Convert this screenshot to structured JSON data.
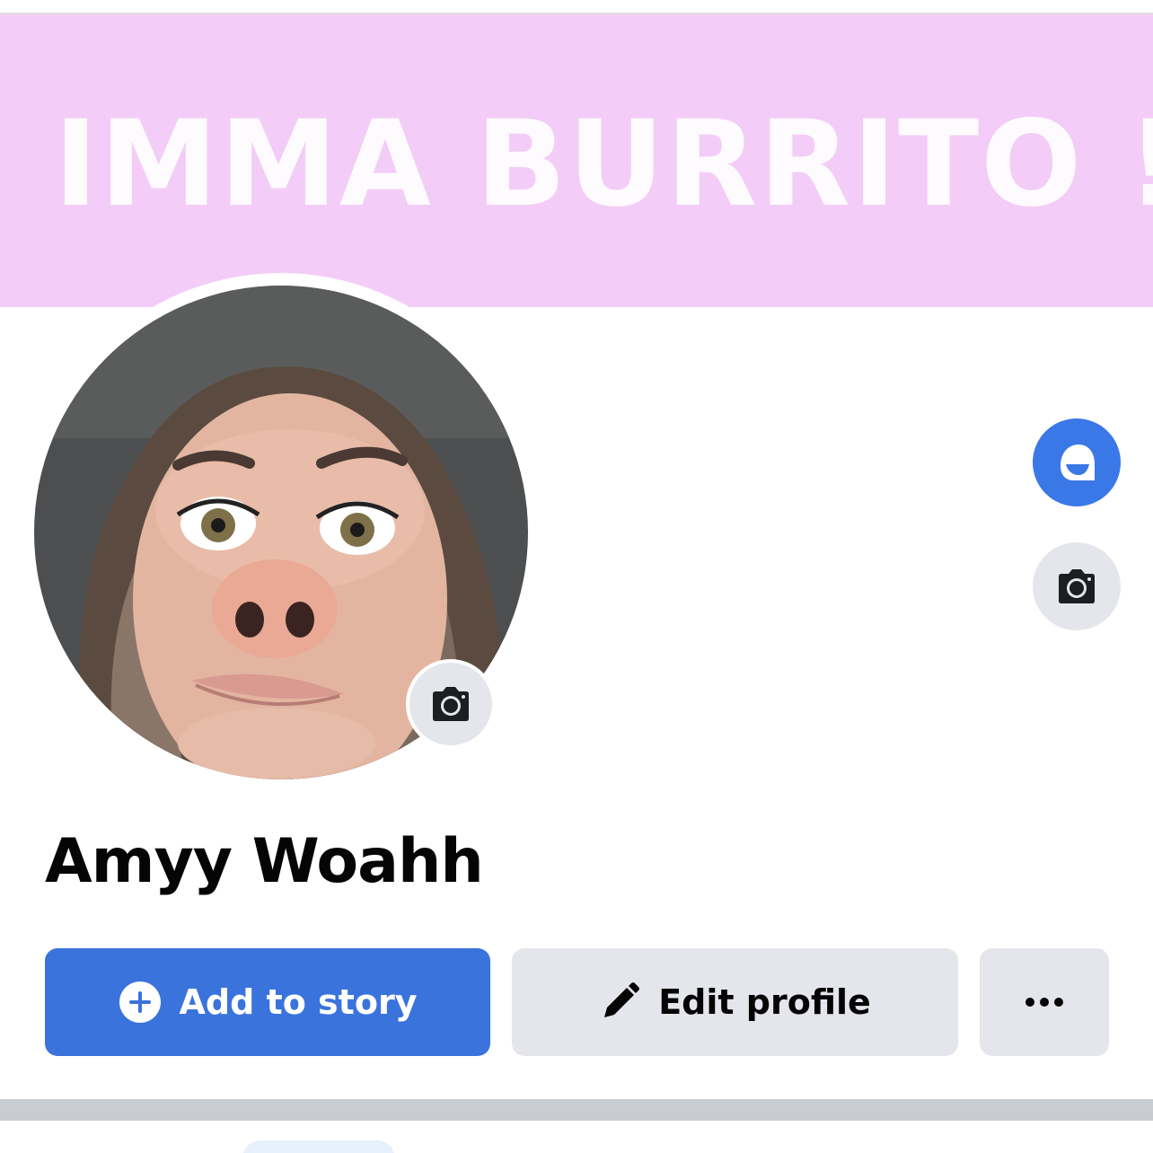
{
  "cover": {
    "text": "IMMA BURRITO !",
    "background_color": "#f3cdf7",
    "camera_icon": "camera-icon"
  },
  "avatar_edit": {
    "icon": "avatar-face-icon",
    "color": "#3b78e7"
  },
  "profile": {
    "name": "Amyy Woahh",
    "camera_icon": "camera-icon"
  },
  "actions": {
    "add_to_story_label": "Add to story",
    "add_to_story_icon": "plus-circle-icon",
    "edit_profile_label": "Edit profile",
    "edit_profile_icon": "pencil-icon",
    "more_icon": "ellipsis-icon",
    "accent_color": "#3b73dc"
  }
}
